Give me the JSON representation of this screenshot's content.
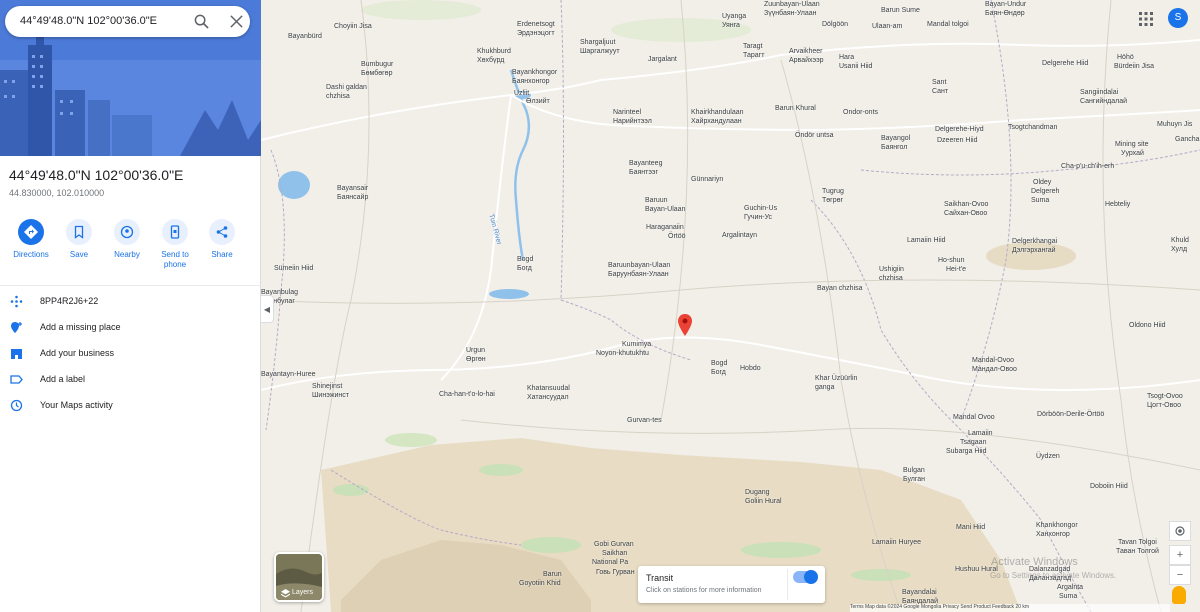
{
  "search": {
    "query": "44°49'48.0\"N 102°00'36.0\"E"
  },
  "place": {
    "title": "44°49'48.0\"N 102°00'36.0\"E",
    "coords": "44.830000, 102.010000"
  },
  "actions": [
    {
      "label": "Directions"
    },
    {
      "label": "Save"
    },
    {
      "label": "Nearby"
    },
    {
      "label": "Send to phone"
    },
    {
      "label": "Share"
    }
  ],
  "info": [
    {
      "label": "8PP4R2J6+22"
    },
    {
      "label": "Add a missing place"
    },
    {
      "label": "Add your business"
    },
    {
      "label": "Add a label"
    },
    {
      "label": "Your Maps activity"
    }
  ],
  "account": {
    "initial": "S"
  },
  "layers": {
    "label": "Layers"
  },
  "transit": {
    "title": "Transit",
    "subtitle": "Click on stations for more information"
  },
  "watermark": {
    "line1": "Activate Windows",
    "line2": "Go to Settings to activate Windows."
  },
  "attribution": "Terms Map data ©2024 Google  Mongolia  Privacy  Send Product Feedback  20 km",
  "colors": {
    "accent": "#1a73e8",
    "map_bg": "#f2efe9",
    "hero": "#4a78d6",
    "pin": "#ea4335"
  },
  "map_labels": [
    {
      "name": "Choyiin Jisa"
    },
    {
      "name": "Bayanbürd"
    },
    {
      "name": "Erdenetsogt"
    },
    {
      "name": "Эрдэнэцогт"
    },
    {
      "name": "Shargaljuut"
    },
    {
      "name": "Шаргалжуут"
    },
    {
      "name": "Uyanga"
    },
    {
      "name": "Уянга"
    },
    {
      "name": "Zuunbayan-Ulaan"
    },
    {
      "name": "Зүүнбаян-Улаан"
    },
    {
      "name": "Dölgöön"
    },
    {
      "name": "Ulaan-am"
    },
    {
      "name": "Barun Sume"
    },
    {
      "name": "Mandal tolgoi"
    },
    {
      "name": "Bayan-Undur"
    },
    {
      "name": "Баян-Өндөр"
    },
    {
      "name": "Khukhburd"
    },
    {
      "name": "Хөхбүрд"
    },
    {
      "name": "Bumbugur"
    },
    {
      "name": "Бөмбөгөр"
    },
    {
      "name": "Bayankhongor"
    },
    {
      "name": "Баянхонгор"
    },
    {
      "name": "Jargalant"
    },
    {
      "name": "Taragt"
    },
    {
      "name": "Тарагт"
    },
    {
      "name": "Arvaikheer"
    },
    {
      "name": "Арвайхээр"
    },
    {
      "name": "Hara"
    },
    {
      "name": "Usanii Hiid"
    },
    {
      "name": "Delgerehe Hiid"
    },
    {
      "name": "Höhö"
    },
    {
      "name": "Bürdeiin Jisa"
    },
    {
      "name": "Dashi galdan"
    },
    {
      "name": "chzhisa"
    },
    {
      "name": "Uzliit"
    },
    {
      "name": "Өлзийт"
    },
    {
      "name": "Sant"
    },
    {
      "name": "Сант"
    },
    {
      "name": "Sangiindalai"
    },
    {
      "name": "Сангийндалай"
    },
    {
      "name": "Narinteel"
    },
    {
      "name": "Нарийнтээл"
    },
    {
      "name": "Khairkhandulaan"
    },
    {
      "name": "Хайрхандулаан"
    },
    {
      "name": "Barun Khural"
    },
    {
      "name": "Ondor-onts"
    },
    {
      "name": "Muhuyn Jis"
    },
    {
      "name": "Delgerehe-Hiyd"
    },
    {
      "name": "Dzeeren Hiid"
    },
    {
      "name": "Tsogtchandman"
    },
    {
      "name": "Öndör untsa"
    },
    {
      "name": "Bayangol"
    },
    {
      "name": "Баянгол"
    },
    {
      "name": "Mining site"
    },
    {
      "name": "Уурхай"
    },
    {
      "name": "Gancha"
    },
    {
      "name": "Bayansair"
    },
    {
      "name": "Баянсайр"
    },
    {
      "name": "Bayanteeg"
    },
    {
      "name": "Баянтээг"
    },
    {
      "name": "Günnariyn"
    },
    {
      "name": "Cha-p'u-ch'ih-erh"
    },
    {
      "name": "Oldey"
    },
    {
      "name": "Delgereh"
    },
    {
      "name": "Suma"
    },
    {
      "name": "Tugrug"
    },
    {
      "name": "Төгрөг"
    },
    {
      "name": "Baruun"
    },
    {
      "name": "Bayan-Ulaan"
    },
    {
      "name": "Guchin-Us"
    },
    {
      "name": "Гучин-Ус"
    },
    {
      "name": "Saikhan-Ovoo"
    },
    {
      "name": "Сайхан-Овоо"
    },
    {
      "name": "Hebteliy"
    },
    {
      "name": "Haraganaiin"
    },
    {
      "name": "Örtöö"
    },
    {
      "name": "Argalintayn"
    },
    {
      "name": "Lamaiin Hiid"
    },
    {
      "name": "Khuld"
    },
    {
      "name": "Хулд"
    },
    {
      "name": "Tuin River"
    },
    {
      "name": "Bogd"
    },
    {
      "name": "Богд"
    },
    {
      "name": "Sümeiin Hiid"
    },
    {
      "name": "Baruunbayan-Ulaan"
    },
    {
      "name": "Баруунбаян-Улаан"
    },
    {
      "name": "Ho-shun"
    },
    {
      "name": "Hei-t'e"
    },
    {
      "name": "Delgerkhangai"
    },
    {
      "name": "Дэлгэрхангай"
    },
    {
      "name": "Ushigiin"
    },
    {
      "name": "chzhisa"
    },
    {
      "name": "Bayan chzhisa"
    },
    {
      "name": "Bayanbulag"
    },
    {
      "name": "Баянбулаг"
    },
    {
      "name": "Oldono Hiid"
    },
    {
      "name": "Kumimya"
    },
    {
      "name": "Noyon-khutukhtu"
    },
    {
      "name": "Urgun"
    },
    {
      "name": "Өргөн"
    },
    {
      "name": "Bogd"
    },
    {
      "name": "Богд"
    },
    {
      "name": "Hobdo"
    },
    {
      "name": "Mandal-Ovoo"
    },
    {
      "name": "Мандал-Овоо"
    },
    {
      "name": "Bayantayn-Huree"
    },
    {
      "name": "Shinejinst"
    },
    {
      "name": "Шинэжинст"
    },
    {
      "name": "Khar Üzüürlin"
    },
    {
      "name": "ganga"
    },
    {
      "name": "Khatansuudal"
    },
    {
      "name": "Хатансуудал"
    },
    {
      "name": "Cha-han-t'o-lo-hai"
    },
    {
      "name": "Tsogt-Ovoo"
    },
    {
      "name": "Цогт-Овоо"
    },
    {
      "name": "Gurvan-tes"
    },
    {
      "name": "Mandal Ovoo"
    },
    {
      "name": "Dörböön-Derile-Örtöö"
    },
    {
      "name": "Lamaiin"
    },
    {
      "name": "Tsagaan"
    },
    {
      "name": "Subarga Hiid"
    },
    {
      "name": "Üydzen"
    },
    {
      "name": "Bulgan"
    },
    {
      "name": "Булган"
    },
    {
      "name": "Dugang"
    },
    {
      "name": "Goliin Hural"
    },
    {
      "name": "Doboiin Hiid"
    },
    {
      "name": "Mani Hiid"
    },
    {
      "name": "Khankhongor"
    },
    {
      "name": "Ханхонгор"
    },
    {
      "name": "Lamaiin Huryee"
    },
    {
      "name": "Tavan Tolgoi"
    },
    {
      "name": "Таван Толгой"
    },
    {
      "name": "Gobi Gurvan"
    },
    {
      "name": "Saikhan"
    },
    {
      "name": "National Pa"
    },
    {
      "name": "Говь Гурван"
    },
    {
      "name": "Barun"
    },
    {
      "name": "Goyotiin Khid"
    },
    {
      "name": "Hushuu Hural"
    },
    {
      "name": "Dalanzadgad"
    },
    {
      "name": "Даланзадгад"
    },
    {
      "name": "Argalnta"
    },
    {
      "name": "Suma"
    },
    {
      "name": "Bayandalai"
    },
    {
      "name": "Баяндалай"
    }
  ]
}
